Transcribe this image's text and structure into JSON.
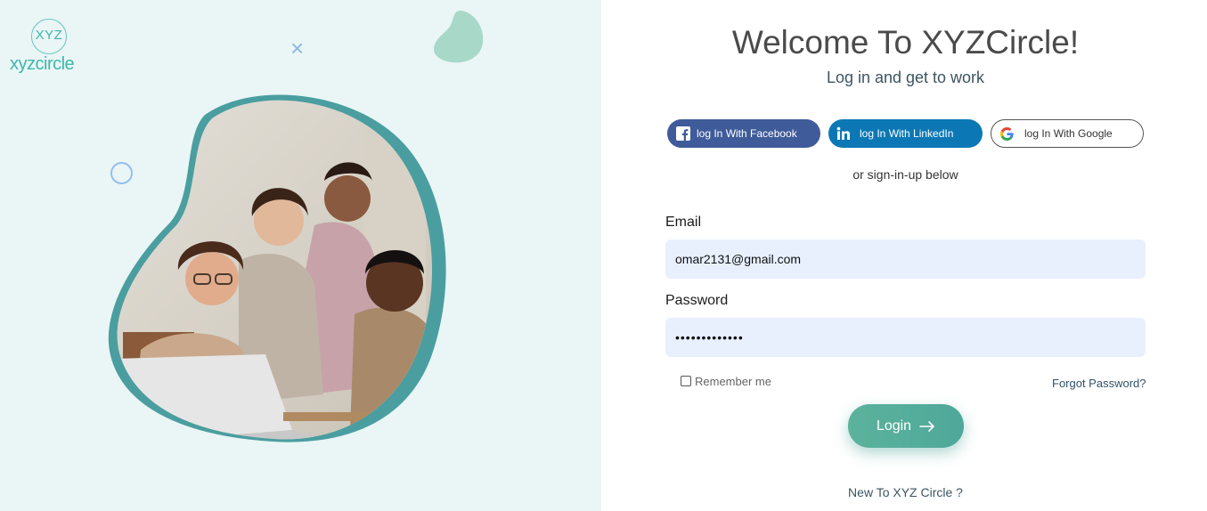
{
  "brand": {
    "logo_mark": "XYZ",
    "logo_wordmark": "xyzcircle",
    "accent_color": "#3fb6ac"
  },
  "hero": {
    "description_icon": "team-photo"
  },
  "header": {
    "title": "Welcome To XYZCircle!",
    "subtitle": "Log in and get to work"
  },
  "social": {
    "facebook_label": "log In With Facebook",
    "facebook_icon": "facebook-icon",
    "facebook_color": "#3f5b9a",
    "linkedin_label": "log In With LinkedIn",
    "linkedin_icon": "linkedin-icon",
    "linkedin_color": "#0b78b5",
    "google_label": "log In With Google",
    "google_icon": "google-icon"
  },
  "divider_text": "or sign-in-up below",
  "form": {
    "email_label": "Email",
    "email_value": "omar2131@gmail.com",
    "password_label": "Password",
    "password_value": "•••••••••••••",
    "remember_label": "Remember me",
    "remember_checked": false,
    "forgot_label": "Forgot Password?",
    "login_label": "Login",
    "login_icon": "arrow-right-icon",
    "login_color": "#5bb39c"
  },
  "footer": {
    "new_account_text": "New To XYZ Circle ?"
  }
}
